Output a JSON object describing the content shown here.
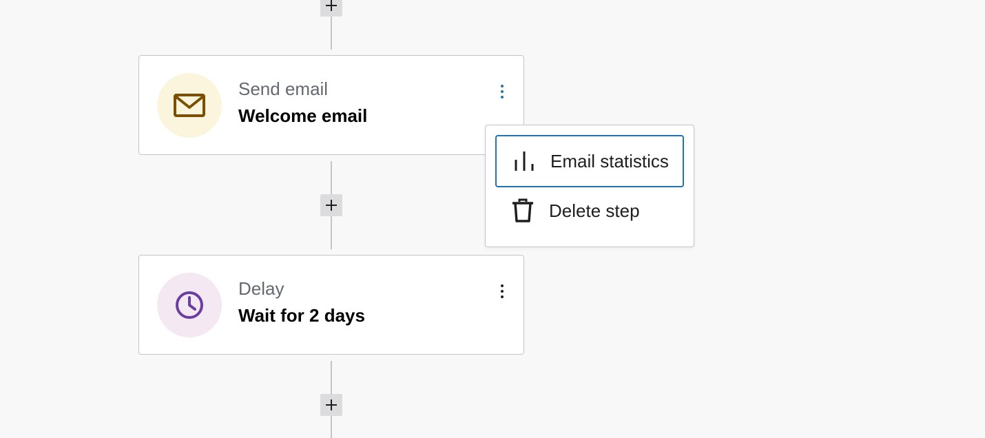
{
  "workflow": {
    "steps": [
      {
        "type": "Send email",
        "name": "Welcome email",
        "icon": "envelope-icon",
        "icon_color": "#7a4f01",
        "icon_bg": "#fcf5de"
      },
      {
        "type": "Delay",
        "name": "Wait for 2 days",
        "icon": "clock-icon",
        "icon_color": "#6b3fa0",
        "icon_bg": "#f4e8f3"
      }
    ],
    "add_step_icon": "plus-icon"
  },
  "step_menu": {
    "items": [
      {
        "label": "Email statistics",
        "icon": "bar-chart-icon"
      },
      {
        "label": "Delete step",
        "icon": "trash-icon"
      }
    ]
  },
  "colors": {
    "accent": "#2271b1",
    "connector": "#c3c4c7",
    "background": "#f8f8f8"
  }
}
